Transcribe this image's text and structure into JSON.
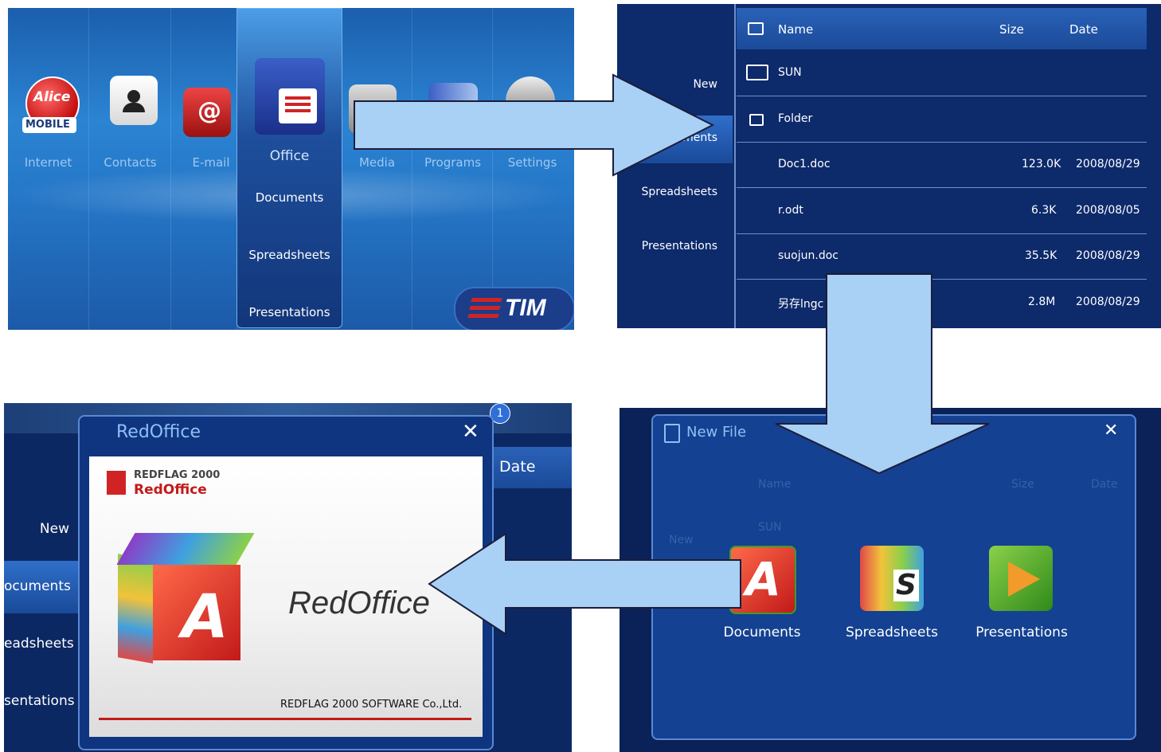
{
  "panel1": {
    "menu": [
      "Internet",
      "Contacts",
      "E-mail",
      "Office",
      "Media",
      "Programs",
      "Settings"
    ],
    "submenu": [
      "Documents",
      "Spreadsheets",
      "Presentations"
    ],
    "logo": "TIM",
    "alice_logo": "Alice",
    "alice_sub": "MOBILE"
  },
  "panel2": {
    "sidebar": [
      "New",
      "Documents",
      "Spreadsheets",
      "Presentations"
    ],
    "sidebar_visible": "uments",
    "columns": {
      "name": "Name",
      "size": "Size",
      "date": "Date"
    },
    "rows": [
      {
        "name": "SUN",
        "size": "",
        "date": ""
      },
      {
        "name": "Folder",
        "size": "",
        "date": ""
      },
      {
        "name": "Doc1.doc",
        "size": "123.0K",
        "date": "2008/08/29"
      },
      {
        "name": "r.odt",
        "size": "6.3K",
        "date": "2008/08/05"
      },
      {
        "name": "suojun.doc",
        "size": "35.5K",
        "date": "2008/08/29"
      },
      {
        "name": "另存lngc",
        "size": "2.8M",
        "date": "2008/08/29"
      }
    ]
  },
  "panel3": {
    "sidebar": [
      "New",
      "ocuments",
      "eadsheets",
      "sentations"
    ],
    "dialog_title": "RedOffice",
    "brand_small": "REDFLAG 2000",
    "brand_name": "RedOffice",
    "product": "RedOffice",
    "company": "REDFLAG 2000 SOFTWARE Co.,Ltd.",
    "date_header": "Date",
    "badge": "1"
  },
  "panel4": {
    "dialog_title": "New File",
    "options": [
      "Documents",
      "Spreadsheets",
      "Presentations"
    ],
    "ghost_new": "New",
    "ghost_name": "Name",
    "ghost_size": "Size",
    "ghost_date": "Date",
    "ghost_sun": "SUN"
  },
  "colors": {
    "arrow": "#a9d0f5",
    "arrow_stroke": "#1d1d3a",
    "panel_bg": "#0d2a6b",
    "accent_red": "#d02424"
  }
}
